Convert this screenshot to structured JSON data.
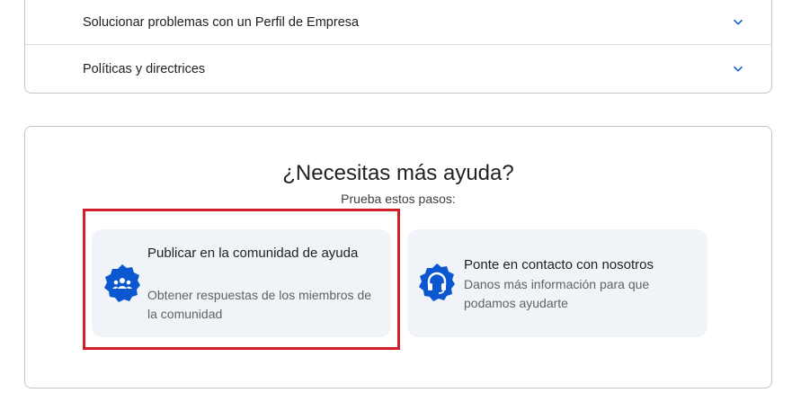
{
  "accordion": {
    "items": [
      {
        "label": "Solucionar problemas con un Perfil de Empresa",
        "icon": "chevron-down-icon"
      },
      {
        "label": "Políticas y directrices",
        "icon": "chevron-down-icon"
      }
    ]
  },
  "help": {
    "title": "¿Necesitas más ayuda?",
    "subtitle": "Prueba estos pasos:",
    "cards": [
      {
        "title": "Publicar en la comunidad de ayuda",
        "description": "Obtener respuestas de los miembros de la comunidad",
        "icon": "community-icon"
      },
      {
        "title": "Ponte en contacto con nosotros",
        "description": "Danos más información para que podamos ayudarte",
        "icon": "headset-icon"
      }
    ]
  },
  "colors": {
    "accent": "#0b57d0",
    "card_bg": "#f0f4f9",
    "highlight": "#d0202b"
  }
}
